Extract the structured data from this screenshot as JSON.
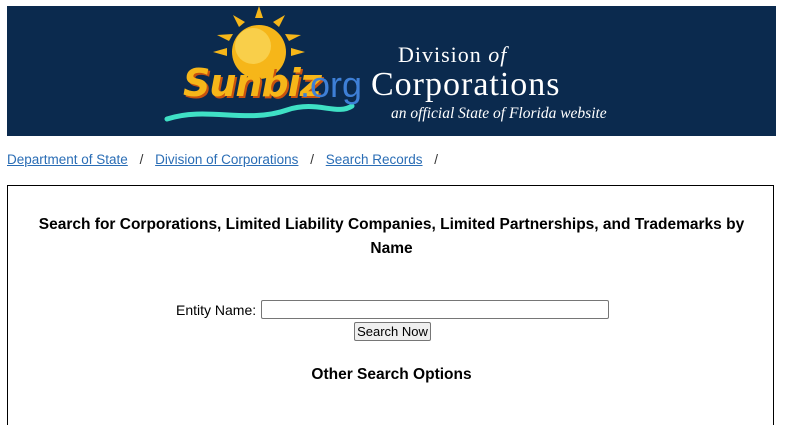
{
  "header": {
    "logo_text": "Sunbiz",
    "logo_tld": ".org",
    "division_prefix": "Division",
    "division_of": "of",
    "corporations": "Corporations",
    "tagline": "an official State of Florida website",
    "colors": {
      "background": "#0b2a4e",
      "sun": "#f6b619",
      "org": "#3e7fd6",
      "wave": "#3fe0c5"
    }
  },
  "breadcrumb": {
    "items": [
      "Department of State",
      "Division of Corporations",
      "Search Records"
    ],
    "separator": "/"
  },
  "search": {
    "title": "Search for Corporations, Limited Liability Companies, Limited Partnerships, and Trademarks by Name",
    "entity_label": "Entity Name:",
    "entity_value": "",
    "button_label": "Search Now",
    "other_options_heading": "Other Search Options"
  }
}
